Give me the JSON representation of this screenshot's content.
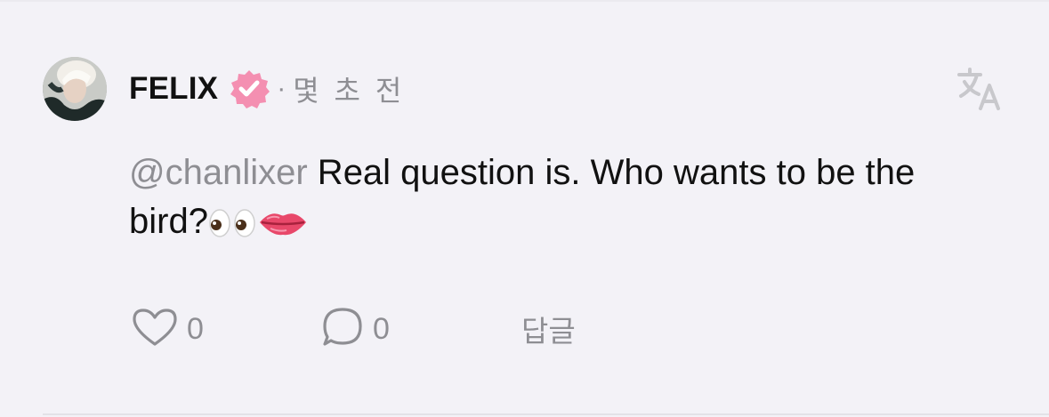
{
  "comment": {
    "username": "FELIX",
    "separator": "·",
    "time": "몇 초 전",
    "mention": "@chanlixer",
    "text_line1": " Real question is. Who wants to be the",
    "text_line2": "bird?",
    "like_count": "0",
    "reply_count": "0",
    "reply_label": "답글"
  },
  "icons": {
    "avatar": "avatar",
    "verified": "verified-badge-icon",
    "translate": "translate-icon",
    "emoji_eyes": "eyes-emoji",
    "emoji_lips": "lips-emoji",
    "like": "heart-icon",
    "comment": "speech-bubble-icon"
  },
  "colors": {
    "background": "#f3f2f7",
    "text": "#111111",
    "muted": "#8e8e93",
    "verified_badge": "#f48fb1"
  }
}
